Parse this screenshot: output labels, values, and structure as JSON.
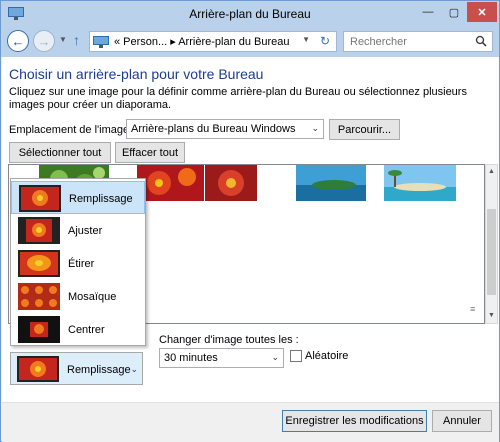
{
  "window": {
    "title": "Arrière-plan du Bureau"
  },
  "titlebar": {
    "min": "—",
    "max": "▢",
    "close": "✕"
  },
  "nav": {
    "breadcrumb": "« Person... ▸ Arrière-plan du Bureau",
    "search_placeholder": "Rechercher"
  },
  "main": {
    "heading": "Choisir un arrière-plan pour votre Bureau",
    "description": "Cliquez sur une image pour la définir comme arrière-plan du Bureau ou sélectionnez plusieurs images pour créer un diaporama.",
    "location_label": "Emplacement de l'image :",
    "location_value": "Arrière-plans du Bureau Windows",
    "browse_button": "Parcourir...",
    "select_all_button": "Sélectionner tout",
    "clear_all_button": "Effacer tout"
  },
  "position_menu": {
    "items": [
      {
        "label": "Remplissage",
        "selected": true
      },
      {
        "label": "Ajuster",
        "selected": false
      },
      {
        "label": "Étirer",
        "selected": false
      },
      {
        "label": "Mosaïque",
        "selected": false
      },
      {
        "label": "Centrer",
        "selected": false
      }
    ],
    "current": "Remplissage"
  },
  "slideshow": {
    "change_label": "Changer d'image toutes les :",
    "interval": "30 minutes",
    "shuffle_label": "Aléatoire"
  },
  "footer": {
    "save_button": "Enregistrer les modifications",
    "cancel_button": "Annuler"
  },
  "colors": {
    "titlebar": "#b9d1ea",
    "heading": "#1e3d8f",
    "close": "#c7504c",
    "selection": "#cce4f7"
  }
}
